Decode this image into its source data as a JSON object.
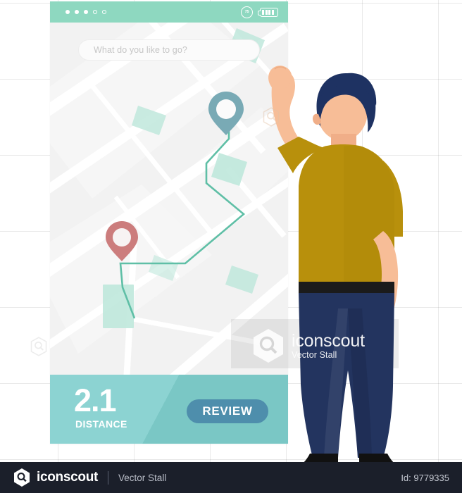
{
  "artwork": {
    "title": "Man using map navigation app",
    "style": "flat-vector-illustration"
  },
  "phone": {
    "status_bar": {
      "signal_dots_filled": 3,
      "signal_dots_total": 5,
      "battery_percent_label": "75",
      "battery_bars": 4,
      "background_color": "#8ed8c0"
    },
    "search": {
      "placeholder": "What do you like to go?",
      "value": ""
    },
    "map": {
      "route_color": "#5fbfa6",
      "origin_pin_color": "#cc7d7d",
      "destination_pin_color": "#79aab5",
      "building_color": "#bfe8dc",
      "road_color": "#ffffff",
      "base_color": "#f2f2f2"
    },
    "bottom_bar": {
      "distance_value": "2.1",
      "distance_label": "DISTANCE",
      "review_label": "REVIEW",
      "background_color": "#7ececc",
      "button_color": "#4e8eac"
    }
  },
  "character": {
    "hair_color": "#1e3262",
    "shirt_color": "#b8900c",
    "skin_color": "#f7bd97",
    "pants_color": "#23345f",
    "shoe_color": "#111111",
    "belt_color": "#1b1b1b"
  },
  "watermark": {
    "center_title": "iconscout",
    "center_subtitle": "Vector Stall"
  },
  "footer": {
    "brand": "iconscout",
    "author": "Vector Stall",
    "id_label": "Id: 9779335",
    "background_color": "#1b1f2a"
  }
}
